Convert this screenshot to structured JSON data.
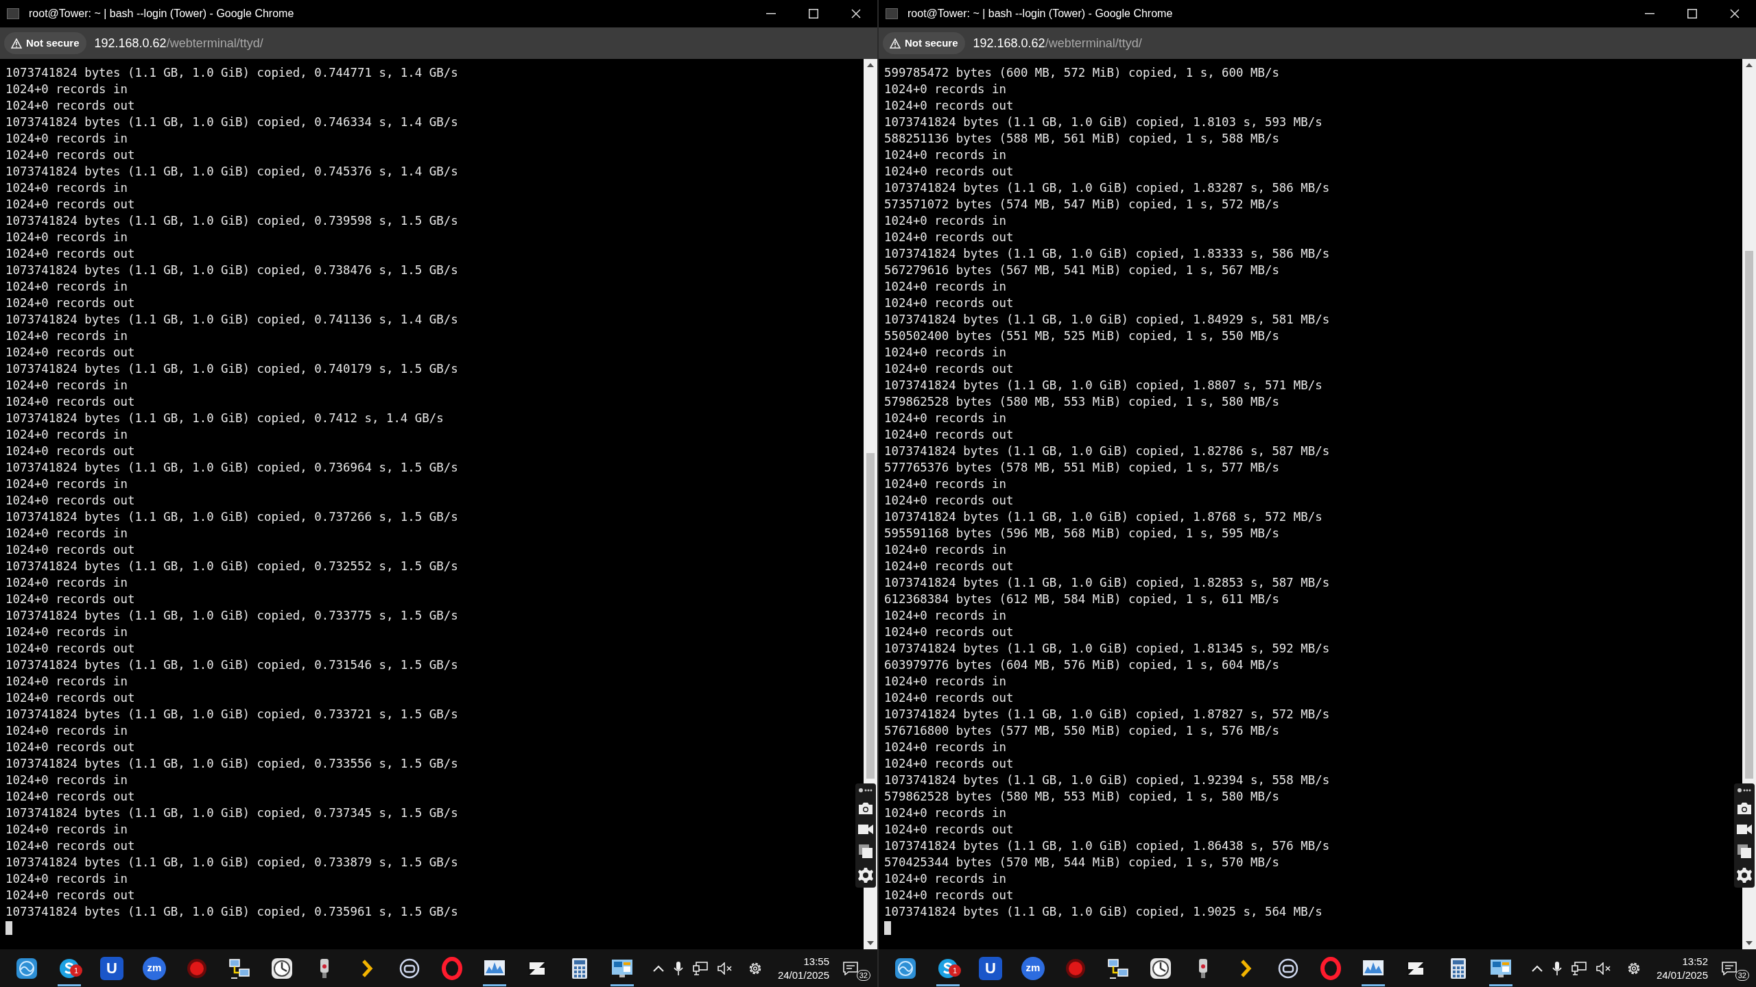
{
  "screens": [
    {
      "window": {
        "title": "root@Tower: ~ | bash --login (Tower) - Google Chrome",
        "security": "Not secure",
        "url_host": "192.168.0.62",
        "url_path": "/webterminal/ttyd/"
      },
      "terminal": {
        "cursor": true,
        "lines": [
          "1073741824 bytes (1.1 GB, 1.0 GiB) copied, 0.744771 s, 1.4 GB/s",
          "1024+0 records in",
          "1024+0 records out",
          "1073741824 bytes (1.1 GB, 1.0 GiB) copied, 0.746334 s, 1.4 GB/s",
          "1024+0 records in",
          "1024+0 records out",
          "1073741824 bytes (1.1 GB, 1.0 GiB) copied, 0.745376 s, 1.4 GB/s",
          "1024+0 records in",
          "1024+0 records out",
          "1073741824 bytes (1.1 GB, 1.0 GiB) copied, 0.739598 s, 1.5 GB/s",
          "1024+0 records in",
          "1024+0 records out",
          "1073741824 bytes (1.1 GB, 1.0 GiB) copied, 0.738476 s, 1.5 GB/s",
          "1024+0 records in",
          "1024+0 records out",
          "1073741824 bytes (1.1 GB, 1.0 GiB) copied, 0.741136 s, 1.4 GB/s",
          "1024+0 records in",
          "1024+0 records out",
          "1073741824 bytes (1.1 GB, 1.0 GiB) copied, 0.740179 s, 1.5 GB/s",
          "1024+0 records in",
          "1024+0 records out",
          "1073741824 bytes (1.1 GB, 1.0 GiB) copied, 0.7412 s, 1.4 GB/s",
          "1024+0 records in",
          "1024+0 records out",
          "1073741824 bytes (1.1 GB, 1.0 GiB) copied, 0.736964 s, 1.5 GB/s",
          "1024+0 records in",
          "1024+0 records out",
          "1073741824 bytes (1.1 GB, 1.0 GiB) copied, 0.737266 s, 1.5 GB/s",
          "1024+0 records in",
          "1024+0 records out",
          "1073741824 bytes (1.1 GB, 1.0 GiB) copied, 0.732552 s, 1.5 GB/s",
          "1024+0 records in",
          "1024+0 records out",
          "1073741824 bytes (1.1 GB, 1.0 GiB) copied, 0.733775 s, 1.5 GB/s",
          "1024+0 records in",
          "1024+0 records out",
          "1073741824 bytes (1.1 GB, 1.0 GiB) copied, 0.731546 s, 1.5 GB/s",
          "1024+0 records in",
          "1024+0 records out",
          "1073741824 bytes (1.1 GB, 1.0 GiB) copied, 0.733721 s, 1.5 GB/s",
          "1024+0 records in",
          "1024+0 records out",
          "1073741824 bytes (1.1 GB, 1.0 GiB) copied, 0.733556 s, 1.5 GB/s",
          "1024+0 records in",
          "1024+0 records out",
          "1073741824 bytes (1.1 GB, 1.0 GiB) copied, 0.737345 s, 1.5 GB/s",
          "1024+0 records in",
          "1024+0 records out",
          "1073741824 bytes (1.1 GB, 1.0 GiB) copied, 0.733879 s, 1.5 GB/s",
          "1024+0 records in",
          "1024+0 records out",
          "1073741824 bytes (1.1 GB, 1.0 GiB) copied, 0.735961 s, 1.5 GB/s"
        ]
      },
      "taskbar": {
        "apps": [
          {
            "kind": "globe",
            "running": false
          },
          {
            "kind": "skype",
            "running": true,
            "badge": "1"
          },
          {
            "kind": "u",
            "running": false,
            "label": "U"
          },
          {
            "kind": "zm",
            "running": false,
            "label": "zm"
          },
          {
            "kind": "record",
            "running": false
          },
          {
            "kind": "network",
            "running": false
          },
          {
            "kind": "clock",
            "running": false
          },
          {
            "kind": "mic",
            "running": false
          },
          {
            "kind": "chevron",
            "running": false
          },
          {
            "kind": "ring",
            "running": false
          },
          {
            "kind": "opera",
            "running": false
          },
          {
            "kind": "chart",
            "running": true
          },
          {
            "kind": "tile",
            "running": false
          },
          {
            "kind": "calculator",
            "running": false
          },
          {
            "kind": "monitor",
            "running": true
          }
        ],
        "time": "13:55",
        "date": "24/01/2025",
        "notifications": "32"
      }
    },
    {
      "window": {
        "title": "root@Tower: ~ | bash --login (Tower) - Google Chrome",
        "security": "Not secure",
        "url_host": "192.168.0.62",
        "url_path": "/webterminal/ttyd/"
      },
      "terminal": {
        "cursor": true,
        "lines": [
          "599785472 bytes (600 MB, 572 MiB) copied, 1 s, 600 MB/s",
          "1024+0 records in",
          "1024+0 records out",
          "1073741824 bytes (1.1 GB, 1.0 GiB) copied, 1.8103 s, 593 MB/s",
          "588251136 bytes (588 MB, 561 MiB) copied, 1 s, 588 MB/s",
          "1024+0 records in",
          "1024+0 records out",
          "1073741824 bytes (1.1 GB, 1.0 GiB) copied, 1.83287 s, 586 MB/s",
          "573571072 bytes (574 MB, 547 MiB) copied, 1 s, 572 MB/s",
          "1024+0 records in",
          "1024+0 records out",
          "1073741824 bytes (1.1 GB, 1.0 GiB) copied, 1.83333 s, 586 MB/s",
          "567279616 bytes (567 MB, 541 MiB) copied, 1 s, 567 MB/s",
          "1024+0 records in",
          "1024+0 records out",
          "1073741824 bytes (1.1 GB, 1.0 GiB) copied, 1.84929 s, 581 MB/s",
          "550502400 bytes (551 MB, 525 MiB) copied, 1 s, 550 MB/s",
          "1024+0 records in",
          "1024+0 records out",
          "1073741824 bytes (1.1 GB, 1.0 GiB) copied, 1.8807 s, 571 MB/s",
          "579862528 bytes (580 MB, 553 MiB) copied, 1 s, 580 MB/s",
          "1024+0 records in",
          "1024+0 records out",
          "1073741824 bytes (1.1 GB, 1.0 GiB) copied, 1.82786 s, 587 MB/s",
          "577765376 bytes (578 MB, 551 MiB) copied, 1 s, 577 MB/s",
          "1024+0 records in",
          "1024+0 records out",
          "1073741824 bytes (1.1 GB, 1.0 GiB) copied, 1.8768 s, 572 MB/s",
          "595591168 bytes (596 MB, 568 MiB) copied, 1 s, 595 MB/s",
          "1024+0 records in",
          "1024+0 records out",
          "1073741824 bytes (1.1 GB, 1.0 GiB) copied, 1.82853 s, 587 MB/s",
          "612368384 bytes (612 MB, 584 MiB) copied, 1 s, 611 MB/s",
          "1024+0 records in",
          "1024+0 records out",
          "1073741824 bytes (1.1 GB, 1.0 GiB) copied, 1.81345 s, 592 MB/s",
          "603979776 bytes (604 MB, 576 MiB) copied, 1 s, 604 MB/s",
          "1024+0 records in",
          "1024+0 records out",
          "1073741824 bytes (1.1 GB, 1.0 GiB) copied, 1.87827 s, 572 MB/s",
          "576716800 bytes (577 MB, 550 MiB) copied, 1 s, 576 MB/s",
          "1024+0 records in",
          "1024+0 records out",
          "1073741824 bytes (1.1 GB, 1.0 GiB) copied, 1.92394 s, 558 MB/s",
          "579862528 bytes (580 MB, 553 MiB) copied, 1 s, 580 MB/s",
          "1024+0 records in",
          "1024+0 records out",
          "1073741824 bytes (1.1 GB, 1.0 GiB) copied, 1.86438 s, 576 MB/s",
          "570425344 bytes (570 MB, 544 MiB) copied, 1 s, 570 MB/s",
          "1024+0 records in",
          "1024+0 records out",
          "1073741824 bytes (1.1 GB, 1.0 GiB) copied, 1.9025 s, 564 MB/s"
        ]
      },
      "taskbar": {
        "apps": [
          {
            "kind": "globe",
            "running": false
          },
          {
            "kind": "skype",
            "running": true,
            "badge": "1"
          },
          {
            "kind": "u",
            "running": false,
            "label": "U"
          },
          {
            "kind": "zm",
            "running": false,
            "label": "zm"
          },
          {
            "kind": "record",
            "running": false
          },
          {
            "kind": "network",
            "running": false
          },
          {
            "kind": "clock",
            "running": false
          },
          {
            "kind": "mic",
            "running": false
          },
          {
            "kind": "chevron",
            "running": false
          },
          {
            "kind": "ring",
            "running": false
          },
          {
            "kind": "opera",
            "running": false
          },
          {
            "kind": "chart",
            "running": true
          },
          {
            "kind": "tile",
            "running": false
          },
          {
            "kind": "calculator",
            "running": false
          },
          {
            "kind": "monitor",
            "running": true
          }
        ],
        "time": "13:52",
        "date": "24/01/2025",
        "notifications": "32"
      }
    }
  ]
}
